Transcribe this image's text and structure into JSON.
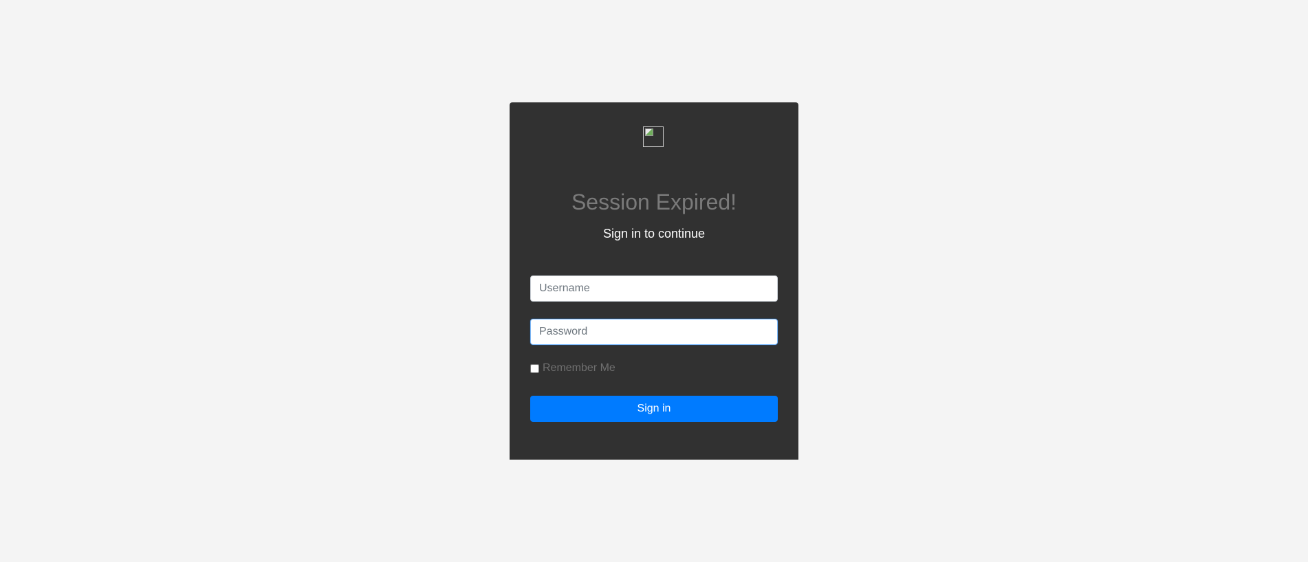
{
  "page": {
    "background": "#f4f4f4"
  },
  "card": {
    "background": "#313131",
    "logo_icon": "broken-image-icon",
    "title": "Session Expired!",
    "subtitle": "Sign in to continue"
  },
  "form": {
    "username": {
      "value": "",
      "placeholder": "Username"
    },
    "password": {
      "value": "",
      "placeholder": "Password"
    },
    "remember_me": {
      "label": "Remember Me",
      "checked": false
    },
    "submit_label": "Sign in",
    "accent_color": "#007bff"
  }
}
